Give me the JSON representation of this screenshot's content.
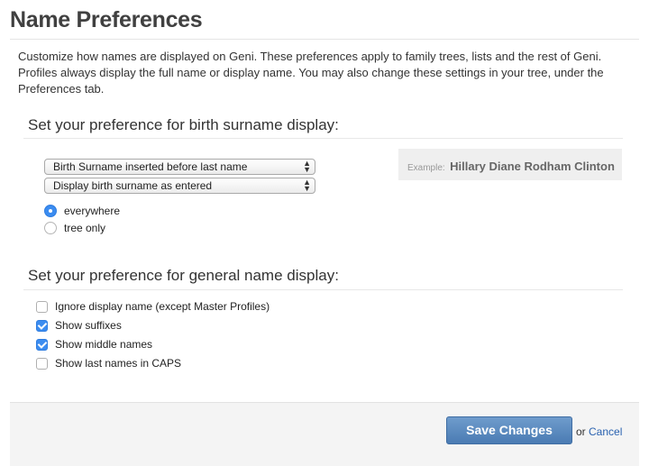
{
  "page": {
    "title": "Name Preferences",
    "intro": "Customize how names are displayed on Geni. These preferences apply to family trees, lists and the rest of Geni. Profiles always display the full name or display name. You may also change these settings in your tree, under the Preferences tab."
  },
  "birth_surname": {
    "heading": "Set your preference for birth surname display:",
    "placement_select": {
      "selected": "Birth Surname inserted before last name"
    },
    "format_select": {
      "selected": "Display birth surname as entered"
    },
    "scope_options": [
      {
        "label": "everywhere",
        "checked": true
      },
      {
        "label": "tree only",
        "checked": false
      }
    ],
    "example": {
      "label": "Example:",
      "name": "Hillary Diane Rodham Clinton"
    }
  },
  "general_name": {
    "heading": "Set your preference for general name display:",
    "options": [
      {
        "label": "Ignore display name (except Master Profiles)",
        "checked": false
      },
      {
        "label": "Show suffixes",
        "checked": true
      },
      {
        "label": "Show middle names",
        "checked": true
      },
      {
        "label": "Show last names in CAPS",
        "checked": false
      }
    ]
  },
  "footer": {
    "save_label": "Save Changes",
    "or_text": "or",
    "cancel_label": "Cancel"
  },
  "colors": {
    "accent": "#3b8cf0",
    "save_button": "#5a8bc2",
    "link": "#2a62b0"
  }
}
